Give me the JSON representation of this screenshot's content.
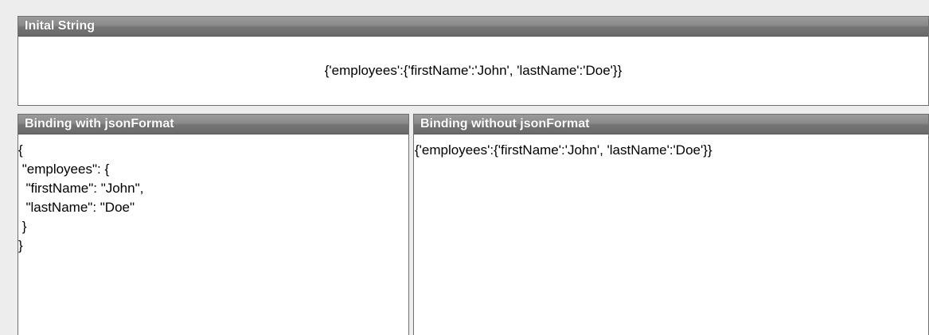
{
  "panels": {
    "initial": {
      "title": "Inital String",
      "value": "{'employees':{'firstName':'John', 'lastName':'Doe'}}"
    },
    "with_format": {
      "title": "Binding with jsonFormat",
      "value": "{\n \"employees\": {\n  \"firstName\": \"John\",\n  \"lastName\": \"Doe\"\n }\n}"
    },
    "without_format": {
      "title": "Binding without jsonFormat",
      "value": "{'employees':{'firstName':'John', 'lastName':'Doe'}}"
    }
  },
  "colors": {
    "header_gradient_top": "#9b9b9b",
    "header_gradient_bottom": "#6a6a6a",
    "header_text": "#ffffff",
    "panel_border": "#6f6f6f",
    "background": "#ededed"
  }
}
